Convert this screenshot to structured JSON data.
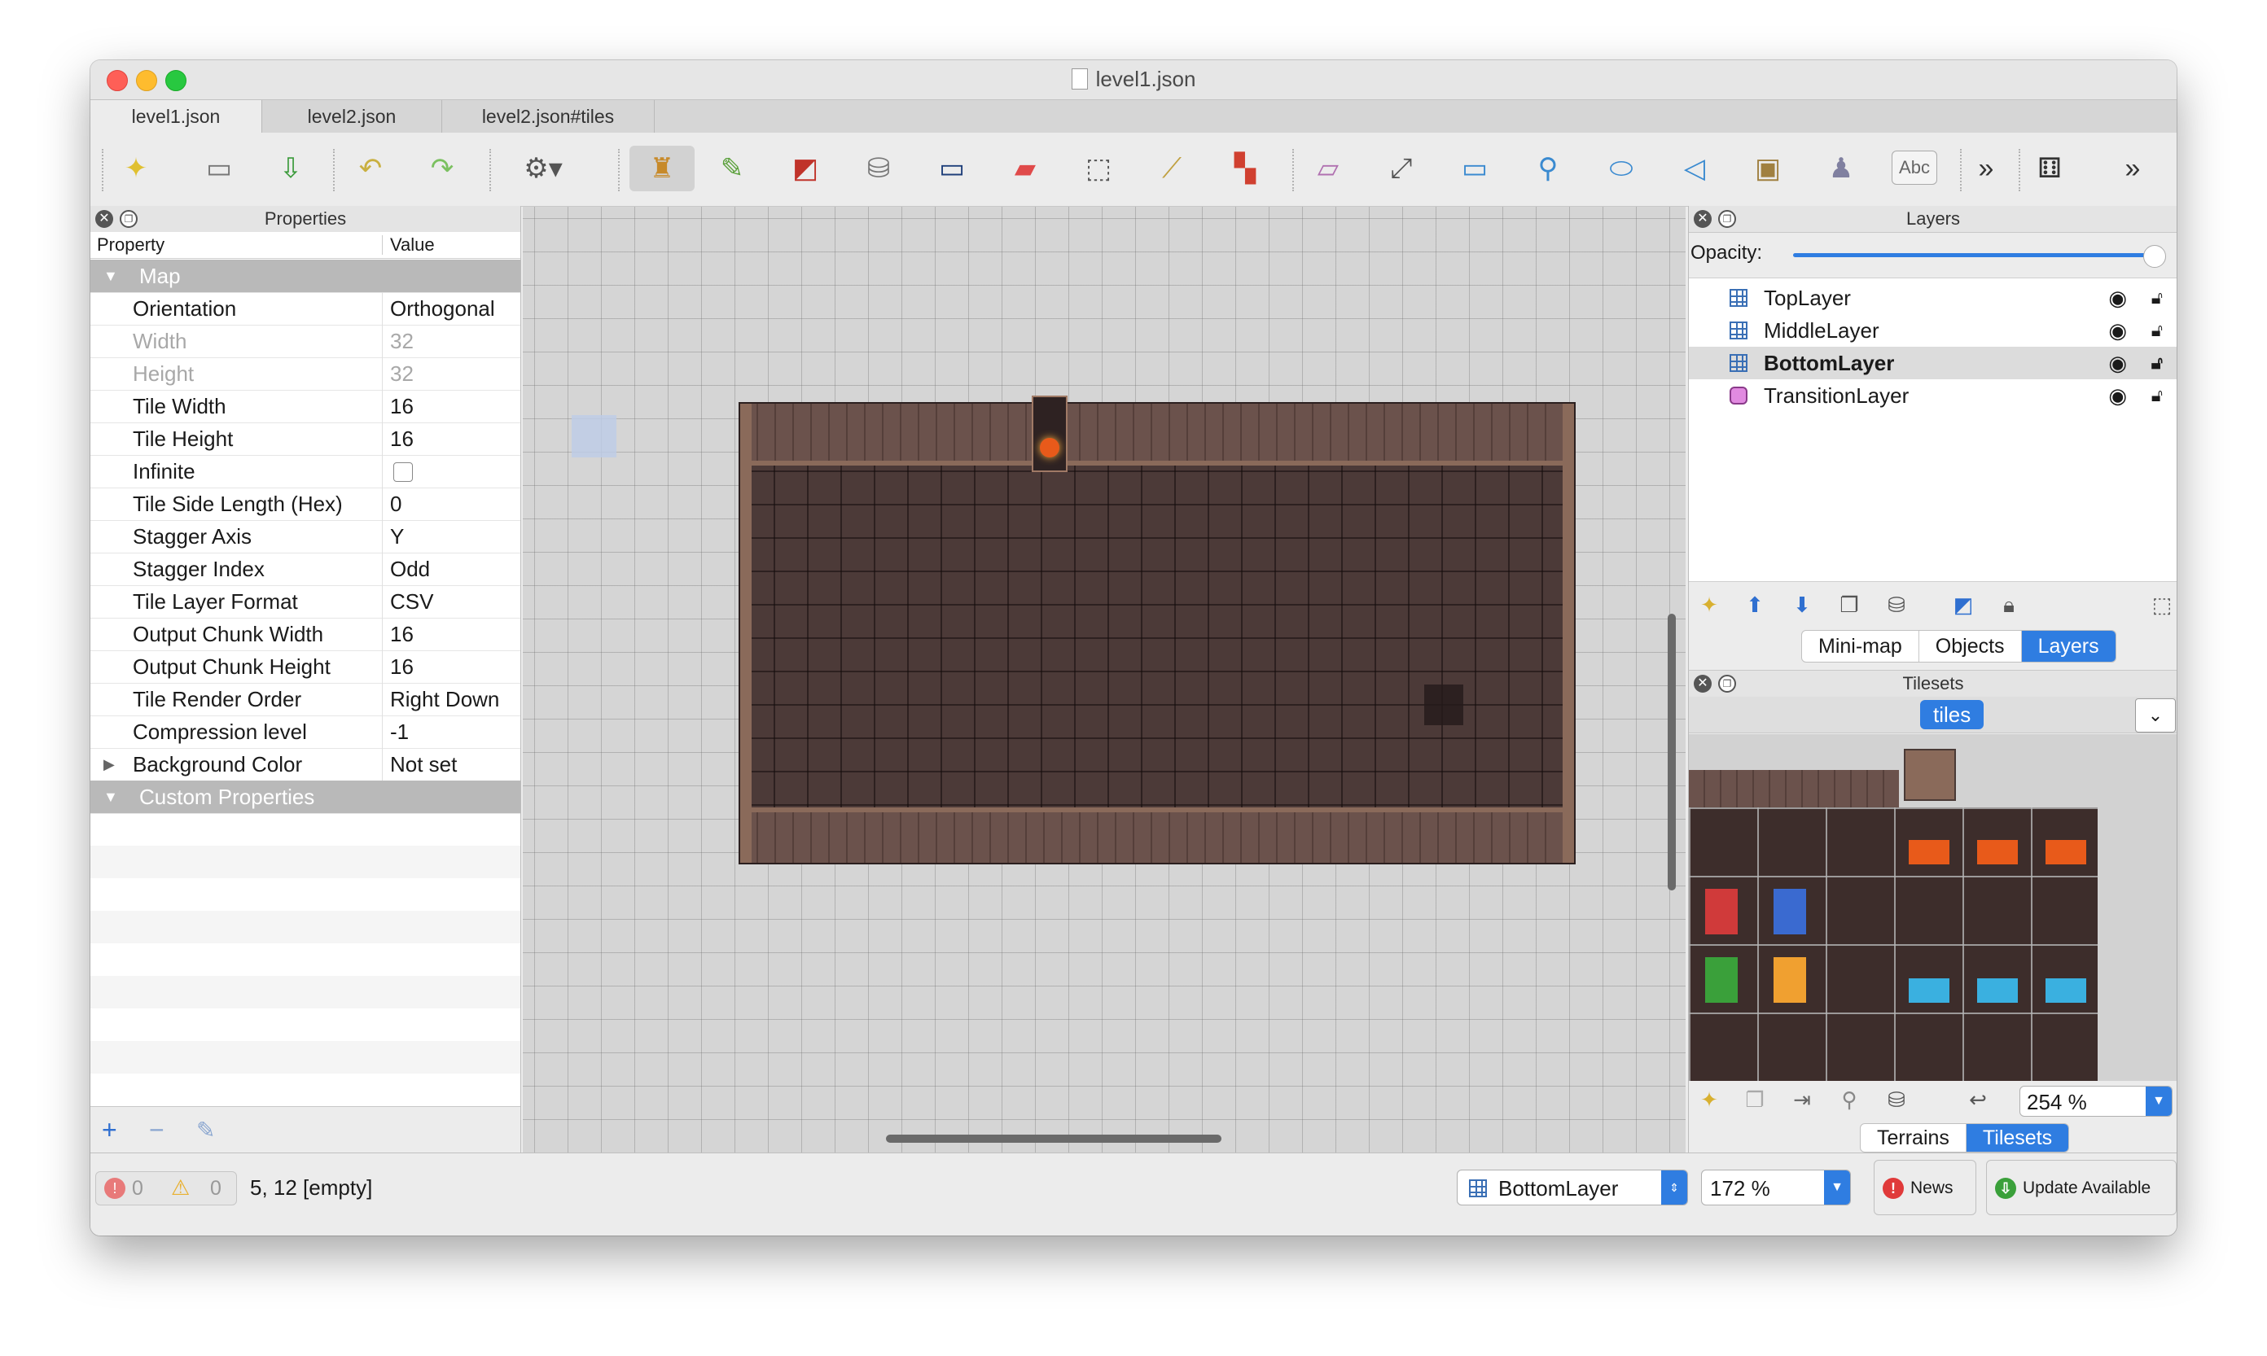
{
  "window": {
    "title": "level1.json"
  },
  "tabs": [
    "level1.json",
    "level2.json",
    "level2.json#tiles"
  ],
  "toolbar": {
    "tools": [
      "new-map-icon",
      "open-icon",
      "save-icon",
      "undo-icon",
      "redo-icon",
      "commands-icon",
      "stamp-brush-icon",
      "terrain-brush-icon",
      "wang-brush-icon",
      "bucket-fill-icon",
      "shape-fill-icon",
      "eraser-icon",
      "rect-select-icon",
      "magic-wand-icon",
      "select-same-tile-icon",
      "select-objects-icon",
      "edit-polygons-icon",
      "insert-rectangle-icon",
      "insert-point-icon",
      "insert-ellipse-icon",
      "insert-polygon-icon",
      "insert-tile-icon",
      "insert-template-icon",
      "insert-text-icon",
      "more-icon",
      "random-mode-icon",
      "more-icon-2"
    ],
    "text_tool_label": "Abc",
    "active_tool": "stamp-brush-icon"
  },
  "properties": {
    "title": "Properties",
    "col_property": "Property",
    "col_value": "Value",
    "group_map": "Map",
    "rows": [
      {
        "k": "Orientation",
        "v": "Orthogonal"
      },
      {
        "k": "Width",
        "v": "32"
      },
      {
        "k": "Height",
        "v": "32"
      },
      {
        "k": "Tile Width",
        "v": "16"
      },
      {
        "k": "Tile Height",
        "v": "16"
      },
      {
        "k": "Infinite",
        "v": ""
      },
      {
        "k": "Tile Side Length (Hex)",
        "v": "0"
      },
      {
        "k": "Stagger Axis",
        "v": "Y"
      },
      {
        "k": "Stagger Index",
        "v": "Odd"
      },
      {
        "k": "Tile Layer Format",
        "v": "CSV"
      },
      {
        "k": "Output Chunk Width",
        "v": "16"
      },
      {
        "k": "Output Chunk Height",
        "v": "16"
      },
      {
        "k": "Tile Render Order",
        "v": "Right Down"
      },
      {
        "k": "Compression level",
        "v": "-1"
      },
      {
        "k": "Background Color",
        "v": "Not set"
      }
    ],
    "group_custom": "Custom Properties"
  },
  "layers": {
    "title": "Layers",
    "opacity_label": "Opacity:",
    "opacity": 1.0,
    "items": [
      {
        "name": "TopLayer",
        "type": "tile"
      },
      {
        "name": "MiddleLayer",
        "type": "tile"
      },
      {
        "name": "BottomLayer",
        "type": "tile",
        "selected": true
      },
      {
        "name": "TransitionLayer",
        "type": "object"
      }
    ],
    "views": [
      "Mini-map",
      "Objects",
      "Layers"
    ],
    "active_view": "Layers"
  },
  "tilesets": {
    "title": "Tilesets",
    "tab": "tiles",
    "zoom": "254 %",
    "views": [
      "Terrains",
      "Tilesets"
    ],
    "active_view": "Tilesets"
  },
  "status": {
    "errors": "0",
    "warnings": "0",
    "coords": "5, 12 [empty]",
    "layer": "BottomLayer",
    "zoom": "172 %",
    "news": "News",
    "update": "Update Available"
  }
}
